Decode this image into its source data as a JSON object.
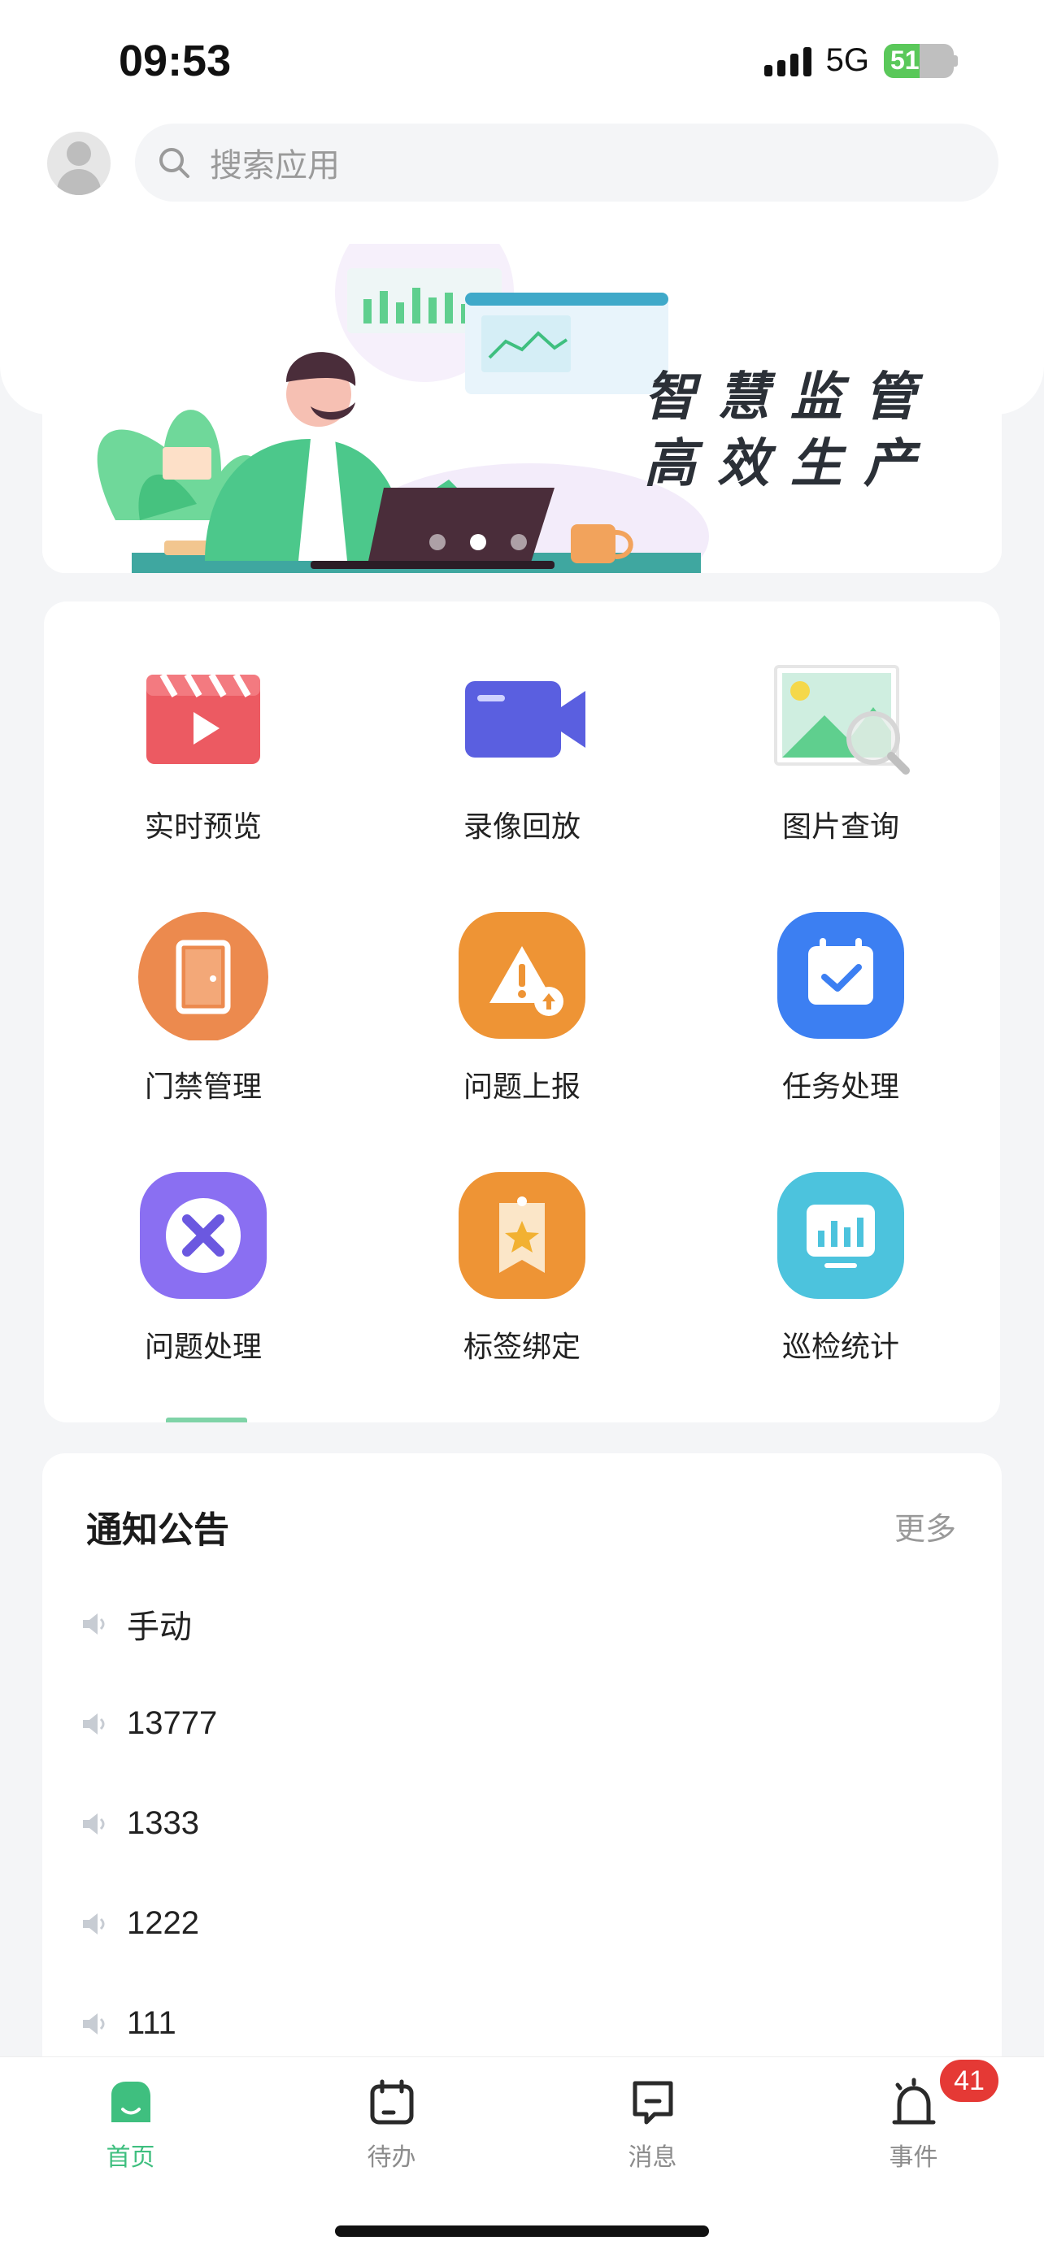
{
  "status_bar": {
    "time": "09:53",
    "network": "5G",
    "battery": "51",
    "battery_level": 0.51
  },
  "search": {
    "placeholder": "搜索应用"
  },
  "banner": {
    "slogan_line1": "智慧监管",
    "slogan_line2": "高效生产",
    "slide_count": 3,
    "active_slide": 2
  },
  "apps": [
    {
      "label": "实时预览",
      "icon": "video-clapper-icon"
    },
    {
      "label": "录像回放",
      "icon": "video-camera-icon"
    },
    {
      "label": "图片查询",
      "icon": "image-search-icon"
    },
    {
      "label": "门禁管理",
      "icon": "door-icon"
    },
    {
      "label": "问题上报",
      "icon": "warning-upload-icon"
    },
    {
      "label": "任务处理",
      "icon": "calendar-check-icon"
    },
    {
      "label": "问题处理",
      "icon": "tools-icon"
    },
    {
      "label": "标签绑定",
      "icon": "tag-star-icon"
    },
    {
      "label": "巡检统计",
      "icon": "chart-monitor-icon"
    }
  ],
  "notices": {
    "title": "通知公告",
    "more": "更多",
    "items": [
      "手动",
      "13777",
      "1333",
      "1222",
      "111"
    ]
  },
  "tabbar": {
    "tabs": [
      {
        "label": "首页",
        "active": true,
        "icon": "home-icon"
      },
      {
        "label": "待办",
        "active": false,
        "icon": "todo-calendar-icon"
      },
      {
        "label": "消息",
        "active": false,
        "icon": "message-icon"
      },
      {
        "label": "事件",
        "active": false,
        "icon": "alarm-bell-icon",
        "badge": "41"
      }
    ]
  },
  "colors": {
    "accent": "#3fbf7f",
    "badge": "#e53935",
    "background": "#f4f5f7"
  }
}
